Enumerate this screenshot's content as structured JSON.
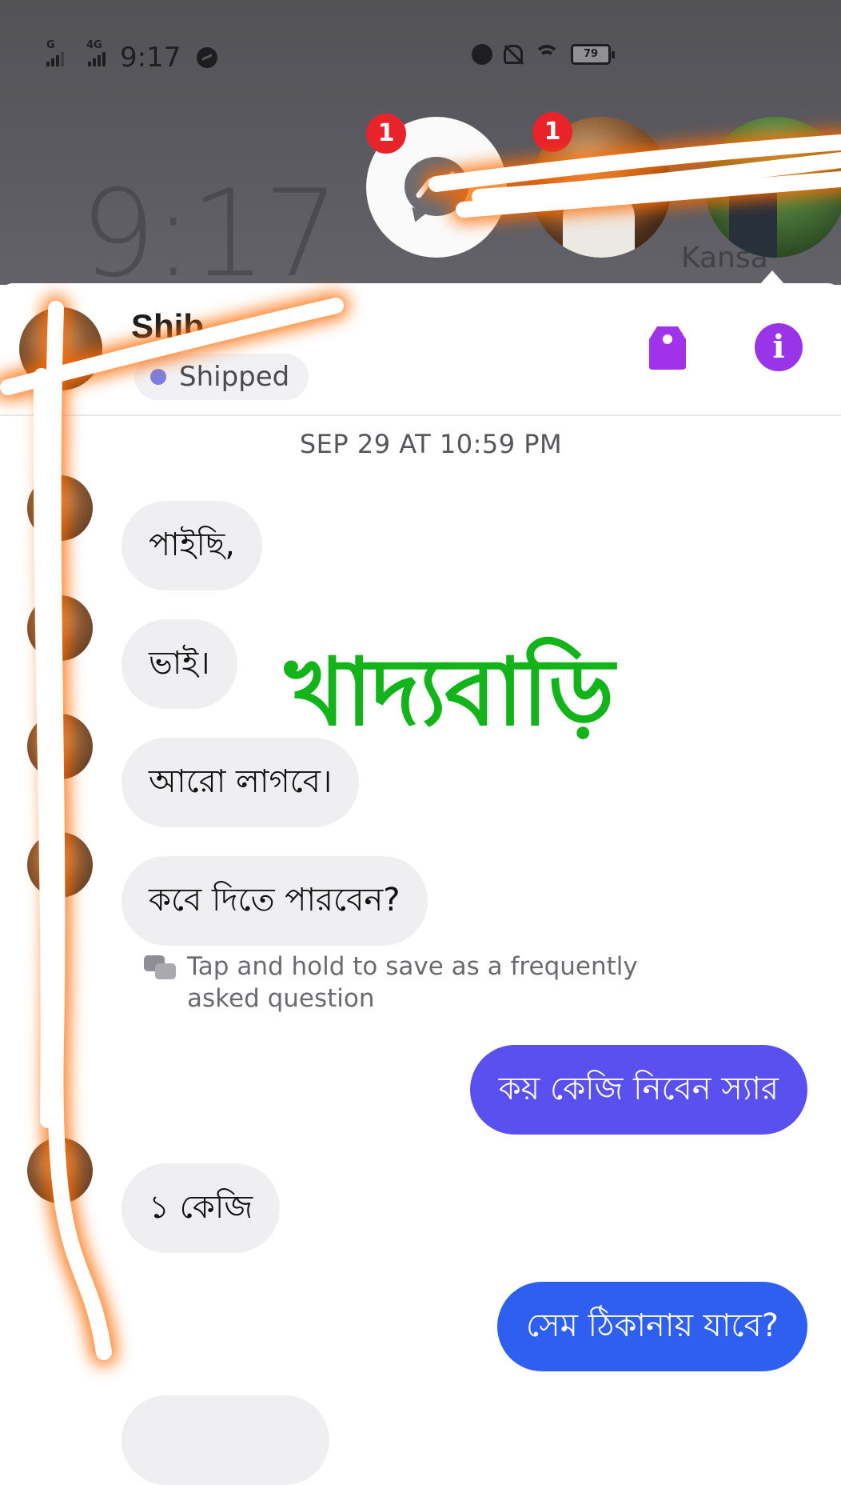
{
  "status_bar": {
    "sim1_label": "G",
    "sim2_label": "4G",
    "time": "9:17",
    "battery": "79"
  },
  "lockscreen": {
    "clock": "9:17",
    "chat_head_caption": "Kansa"
  },
  "chat_heads": {
    "messenger_badge": "1",
    "contact_badge": "1"
  },
  "conversation": {
    "contact_name": "Shib",
    "label": "Shipped",
    "label_dot_color": "#7b7fe0",
    "timestamp": "SEP 29 AT 10:59 PM",
    "messages": [
      {
        "from": "contact",
        "text": "পাইছি,"
      },
      {
        "from": "contact",
        "text": "ভাই।"
      },
      {
        "from": "contact",
        "text": "আরো লাগবে।"
      },
      {
        "from": "contact",
        "text": "কবে দিতে পারবেন?"
      },
      {
        "from": "me",
        "text": "কয় কেজি নিবেন স্যার"
      },
      {
        "from": "contact",
        "text": "১ কেজি"
      },
      {
        "from": "me",
        "text": "সেম ঠিকানায় যাবে?"
      }
    ],
    "faq_hint": "Tap and hold to save as a frequently asked question"
  },
  "watermark": "খাদ্যবাড়ি",
  "colors": {
    "accent_purple": "#9a34e8",
    "outgoing_bubble": "#5a50ef",
    "outgoing_bubble_last": "#2f5ff0",
    "incoming_bubble": "#efeff1",
    "watermark_green": "#12b41a",
    "badge_red": "#e8232a"
  },
  "icons": {
    "header_tag": "tag-icon",
    "header_info": "info-icon",
    "faq": "faq-chat-icon",
    "chat_head": "messenger-icon"
  }
}
